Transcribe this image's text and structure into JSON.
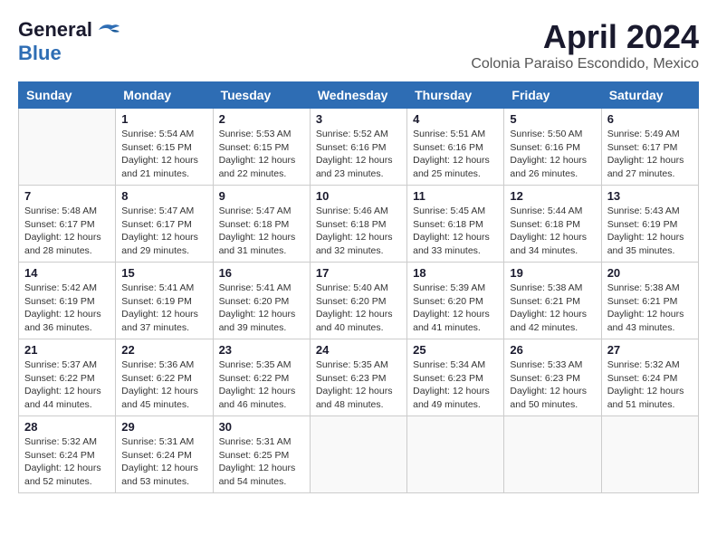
{
  "logo": {
    "general": "General",
    "blue": "Blue"
  },
  "title": "April 2024",
  "location": "Colonia Paraiso Escondido, Mexico",
  "days_of_week": [
    "Sunday",
    "Monday",
    "Tuesday",
    "Wednesday",
    "Thursday",
    "Friday",
    "Saturday"
  ],
  "weeks": [
    [
      {
        "day": "",
        "empty": true
      },
      {
        "day": "1",
        "sunrise": "Sunrise: 5:54 AM",
        "sunset": "Sunset: 6:15 PM",
        "daylight": "Daylight: 12 hours and 21 minutes."
      },
      {
        "day": "2",
        "sunrise": "Sunrise: 5:53 AM",
        "sunset": "Sunset: 6:15 PM",
        "daylight": "Daylight: 12 hours and 22 minutes."
      },
      {
        "day": "3",
        "sunrise": "Sunrise: 5:52 AM",
        "sunset": "Sunset: 6:16 PM",
        "daylight": "Daylight: 12 hours and 23 minutes."
      },
      {
        "day": "4",
        "sunrise": "Sunrise: 5:51 AM",
        "sunset": "Sunset: 6:16 PM",
        "daylight": "Daylight: 12 hours and 25 minutes."
      },
      {
        "day": "5",
        "sunrise": "Sunrise: 5:50 AM",
        "sunset": "Sunset: 6:16 PM",
        "daylight": "Daylight: 12 hours and 26 minutes."
      },
      {
        "day": "6",
        "sunrise": "Sunrise: 5:49 AM",
        "sunset": "Sunset: 6:17 PM",
        "daylight": "Daylight: 12 hours and 27 minutes."
      }
    ],
    [
      {
        "day": "7",
        "sunrise": "Sunrise: 5:48 AM",
        "sunset": "Sunset: 6:17 PM",
        "daylight": "Daylight: 12 hours and 28 minutes."
      },
      {
        "day": "8",
        "sunrise": "Sunrise: 5:47 AM",
        "sunset": "Sunset: 6:17 PM",
        "daylight": "Daylight: 12 hours and 29 minutes."
      },
      {
        "day": "9",
        "sunrise": "Sunrise: 5:47 AM",
        "sunset": "Sunset: 6:18 PM",
        "daylight": "Daylight: 12 hours and 31 minutes."
      },
      {
        "day": "10",
        "sunrise": "Sunrise: 5:46 AM",
        "sunset": "Sunset: 6:18 PM",
        "daylight": "Daylight: 12 hours and 32 minutes."
      },
      {
        "day": "11",
        "sunrise": "Sunrise: 5:45 AM",
        "sunset": "Sunset: 6:18 PM",
        "daylight": "Daylight: 12 hours and 33 minutes."
      },
      {
        "day": "12",
        "sunrise": "Sunrise: 5:44 AM",
        "sunset": "Sunset: 6:18 PM",
        "daylight": "Daylight: 12 hours and 34 minutes."
      },
      {
        "day": "13",
        "sunrise": "Sunrise: 5:43 AM",
        "sunset": "Sunset: 6:19 PM",
        "daylight": "Daylight: 12 hours and 35 minutes."
      }
    ],
    [
      {
        "day": "14",
        "sunrise": "Sunrise: 5:42 AM",
        "sunset": "Sunset: 6:19 PM",
        "daylight": "Daylight: 12 hours and 36 minutes."
      },
      {
        "day": "15",
        "sunrise": "Sunrise: 5:41 AM",
        "sunset": "Sunset: 6:19 PM",
        "daylight": "Daylight: 12 hours and 37 minutes."
      },
      {
        "day": "16",
        "sunrise": "Sunrise: 5:41 AM",
        "sunset": "Sunset: 6:20 PM",
        "daylight": "Daylight: 12 hours and 39 minutes."
      },
      {
        "day": "17",
        "sunrise": "Sunrise: 5:40 AM",
        "sunset": "Sunset: 6:20 PM",
        "daylight": "Daylight: 12 hours and 40 minutes."
      },
      {
        "day": "18",
        "sunrise": "Sunrise: 5:39 AM",
        "sunset": "Sunset: 6:20 PM",
        "daylight": "Daylight: 12 hours and 41 minutes."
      },
      {
        "day": "19",
        "sunrise": "Sunrise: 5:38 AM",
        "sunset": "Sunset: 6:21 PM",
        "daylight": "Daylight: 12 hours and 42 minutes."
      },
      {
        "day": "20",
        "sunrise": "Sunrise: 5:38 AM",
        "sunset": "Sunset: 6:21 PM",
        "daylight": "Daylight: 12 hours and 43 minutes."
      }
    ],
    [
      {
        "day": "21",
        "sunrise": "Sunrise: 5:37 AM",
        "sunset": "Sunset: 6:22 PM",
        "daylight": "Daylight: 12 hours and 44 minutes."
      },
      {
        "day": "22",
        "sunrise": "Sunrise: 5:36 AM",
        "sunset": "Sunset: 6:22 PM",
        "daylight": "Daylight: 12 hours and 45 minutes."
      },
      {
        "day": "23",
        "sunrise": "Sunrise: 5:35 AM",
        "sunset": "Sunset: 6:22 PM",
        "daylight": "Daylight: 12 hours and 46 minutes."
      },
      {
        "day": "24",
        "sunrise": "Sunrise: 5:35 AM",
        "sunset": "Sunset: 6:23 PM",
        "daylight": "Daylight: 12 hours and 48 minutes."
      },
      {
        "day": "25",
        "sunrise": "Sunrise: 5:34 AM",
        "sunset": "Sunset: 6:23 PM",
        "daylight": "Daylight: 12 hours and 49 minutes."
      },
      {
        "day": "26",
        "sunrise": "Sunrise: 5:33 AM",
        "sunset": "Sunset: 6:23 PM",
        "daylight": "Daylight: 12 hours and 50 minutes."
      },
      {
        "day": "27",
        "sunrise": "Sunrise: 5:32 AM",
        "sunset": "Sunset: 6:24 PM",
        "daylight": "Daylight: 12 hours and 51 minutes."
      }
    ],
    [
      {
        "day": "28",
        "sunrise": "Sunrise: 5:32 AM",
        "sunset": "Sunset: 6:24 PM",
        "daylight": "Daylight: 12 hours and 52 minutes."
      },
      {
        "day": "29",
        "sunrise": "Sunrise: 5:31 AM",
        "sunset": "Sunset: 6:24 PM",
        "daylight": "Daylight: 12 hours and 53 minutes."
      },
      {
        "day": "30",
        "sunrise": "Sunrise: 5:31 AM",
        "sunset": "Sunset: 6:25 PM",
        "daylight": "Daylight: 12 hours and 54 minutes."
      },
      {
        "day": "",
        "empty": true
      },
      {
        "day": "",
        "empty": true
      },
      {
        "day": "",
        "empty": true
      },
      {
        "day": "",
        "empty": true
      }
    ]
  ]
}
